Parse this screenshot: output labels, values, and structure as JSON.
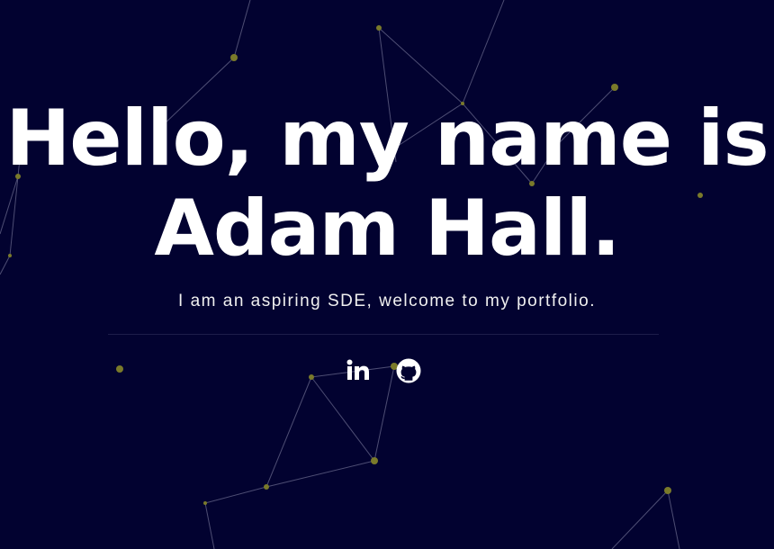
{
  "hero": {
    "headline_line1": "Hello, my name is",
    "headline_line2": "Adam Hall.",
    "subtitle": "I am an aspiring SDE, welcome to my portfolio."
  },
  "social": {
    "links": [
      {
        "name": "LinkedIn",
        "icon": "linkedin-icon"
      },
      {
        "name": "GitHub",
        "icon": "github-icon"
      }
    ]
  },
  "colors": {
    "background": "#020230",
    "text": "#ffffff",
    "particle": "#6b6b2a",
    "line": "#9a9ab8"
  }
}
